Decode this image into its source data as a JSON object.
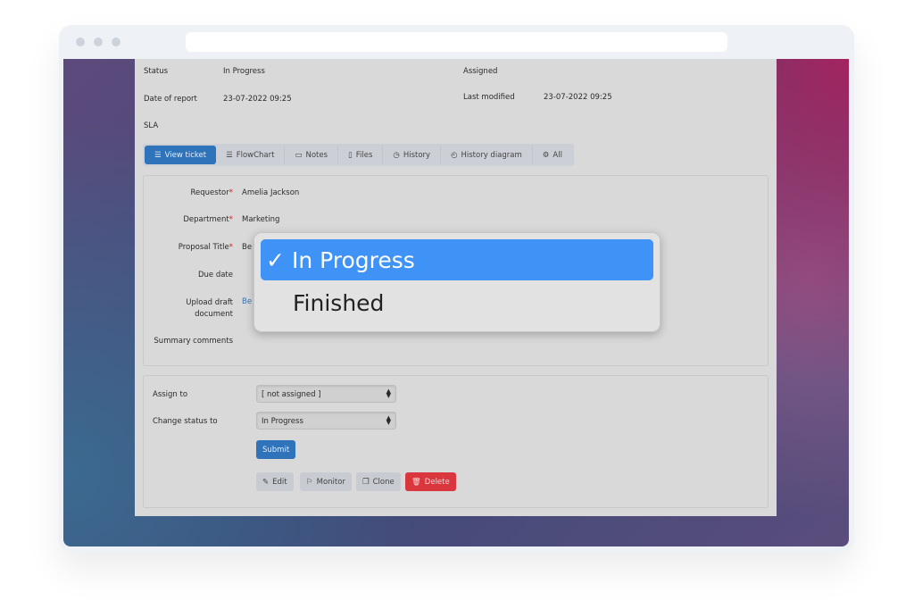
{
  "info": {
    "status_label": "Status",
    "status_value": "In Progress",
    "assigned_label": "Assigned",
    "date_label": "Date of report",
    "date_value": "23-07-2022 09:25",
    "modified_label": "Last modified",
    "modified_value": "23-07-2022 09:25",
    "sla_label": "SLA"
  },
  "tabs": [
    {
      "label": "View ticket",
      "icon": "list-icon"
    },
    {
      "label": "FlowChart",
      "icon": "list-icon"
    },
    {
      "label": "Notes",
      "icon": "comment-icon"
    },
    {
      "label": "Files",
      "icon": "file-icon"
    },
    {
      "label": "History",
      "icon": "clock-icon"
    },
    {
      "label": "History diagram",
      "icon": "stopwatch-icon"
    },
    {
      "label": "All",
      "icon": "gears-icon"
    }
  ],
  "form": {
    "requestor_label": "Requestor",
    "requestor_value": "Amelia Jackson",
    "department_label": "Department",
    "department_value": "Marketing",
    "title_label": "Proposal Title",
    "title_value": "Be",
    "due_label": "Due date",
    "upload_label": "Upload draft document",
    "upload_value": "Be",
    "summary_label": "Summary comments",
    "required_mark": "*"
  },
  "actions": {
    "assign_label": "Assign to",
    "assign_value": "[ not assigned ]",
    "status_label": "Change status to",
    "status_value": "In Progress",
    "submit": "Submit",
    "edit": "Edit",
    "monitor": "Monitor",
    "clone": "Clone",
    "delete": "Delete"
  },
  "dropdown": {
    "options": [
      {
        "label": "In Progress",
        "selected": true,
        "check": "✓"
      },
      {
        "label": "Finished",
        "selected": false
      }
    ]
  },
  "colors": {
    "primary": "#2f74ba",
    "danger": "#d9363e",
    "highlight": "#3f93f7"
  }
}
